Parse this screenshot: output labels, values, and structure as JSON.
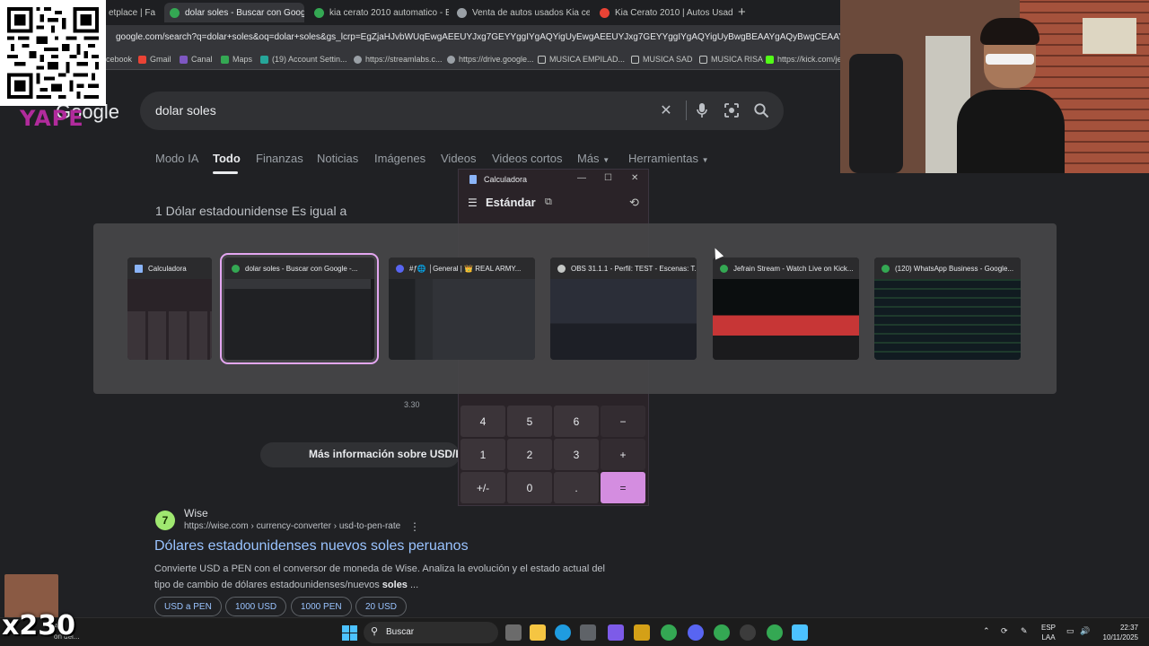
{
  "browser": {
    "tabs": [
      {
        "title": "etplace | Fa",
        "color": "#5f6368"
      },
      {
        "title": "dolar soles - Buscar con Google",
        "color": "#34a853"
      },
      {
        "title": "kia cerato 2010 automatico - B",
        "color": "#34a853"
      },
      {
        "title": "Venta de autos usados Kia cera",
        "color": "#9aa0a6"
      },
      {
        "title": "Kia Cerato 2010 | Autos Usado",
        "color": "#ea4335"
      }
    ],
    "url": "google.com/search?q=dolar+soles&oq=dolar+soles&gs_lcrp=EgZjaHJvbWUqEwgAEEUYJxg7GEYYggIYgAQYigUyEwgAEEUYJxg7GEYYggIYgAQYigUyBwgBEAAYgAQyBwgCEAAYgAQyBwgDEAAYgAQy",
    "bookmarks": [
      {
        "label": "cebook",
        "color": "#1877f2"
      },
      {
        "label": "Gmail",
        "color": "#ea4335"
      },
      {
        "label": "Canal",
        "color": "#7e57c2"
      },
      {
        "label": "Maps",
        "color": "#34a853"
      },
      {
        "label": "(19) Account Settin...",
        "color": "#26a69a"
      },
      {
        "label": "https://streamlabs.c...",
        "color": "#9aa0a6"
      },
      {
        "label": "https://drive.google...",
        "color": "#9aa0a6"
      },
      {
        "label": "MUSICA EMPILAD...",
        "color": "#c4c7c5"
      },
      {
        "label": "MUSICA SAD",
        "color": "#c4c7c5"
      },
      {
        "label": "MUSICA RISA",
        "color": "#c4c7c5"
      },
      {
        "label": "https://kick.com/jef",
        "color": "#53fc18"
      }
    ]
  },
  "overlay": {
    "yape": "YAPE",
    "google_logo": "Google",
    "counter": "x230"
  },
  "search": {
    "query": "dolar soles",
    "tabs": [
      "Modo IA",
      "Todo",
      "Finanzas",
      "Noticias",
      "Imágenes",
      "Videos",
      "Videos cortos",
      "Más",
      "Herramientas"
    ],
    "active_tab": "Todo",
    "converter_title": "1 Dólar estadounidense Es igual a",
    "axis_tick": "3.30",
    "more_info": "Más información sobre USD/PE"
  },
  "calculator": {
    "window_title": "Calculadora",
    "mode": "Estándar",
    "keys": [
      "4",
      "5",
      "6",
      "−",
      "1",
      "2",
      "3",
      "+",
      "+/-",
      "0",
      ".",
      "="
    ]
  },
  "switcher": {
    "windows": [
      {
        "title": "Calculadora",
        "icon_color": "#8ab4f8",
        "selected": false
      },
      {
        "title": "dolar soles - Buscar con Google -...",
        "icon_color": "#34a853",
        "selected": true
      },
      {
        "title": "#ƒ🌐 │General | 👑 REAL ARMY...",
        "icon_color": "#5865f2",
        "selected": false
      },
      {
        "title": "OBS 31.1.1 - Perfil: TEST - Escenas: T...",
        "icon_color": "#c4c7c5",
        "selected": false
      },
      {
        "title": "Jefrain Stream - Watch Live on Kick...",
        "icon_color": "#34a853",
        "selected": false
      },
      {
        "title": "(120) WhatsApp Business - Google...",
        "icon_color": "#34a853",
        "selected": false
      }
    ]
  },
  "result": {
    "site_name": "Wise",
    "site_url": "https://wise.com › currency-converter › usd-to-pen-rate",
    "title": "Dólares estadounidenses nuevos soles peruanos",
    "snippet_1": "Convierte USD a PEN con el conversor de moneda de Wise. Analiza la evolución y el estado actual del",
    "snippet_2": "tipo de cambio de dólares estadounidenses/nuevos ",
    "snippet_bold": "soles",
    "snippet_end": " ...",
    "chips": [
      "USD a PEN",
      "1000 USD",
      "1000 PEN",
      "20 USD"
    ]
  },
  "taskbar": {
    "left_text_1": "A",
    "left_text_2": "on del...",
    "search_label": "Buscar",
    "lang_1": "ESP",
    "lang_2": "LAA",
    "time": "22:37",
    "date": "10/11/2025"
  }
}
